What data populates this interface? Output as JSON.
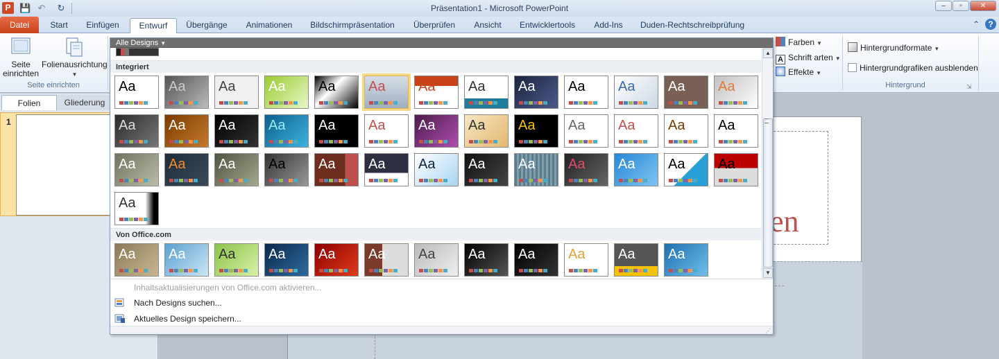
{
  "titlebar": {
    "title": "Präsentation1 - Microsoft PowerPoint",
    "app_icon_letter": "P",
    "quick_access": {
      "save": "💾",
      "undo": "↶",
      "redo": "↻"
    },
    "window_buttons": {
      "minimize": "–",
      "maximize": "▫",
      "close": "✕"
    }
  },
  "tabs": [
    {
      "label": "Datei"
    },
    {
      "label": "Start"
    },
    {
      "label": "Einfügen"
    },
    {
      "label": "Entwurf"
    },
    {
      "label": "Übergänge"
    },
    {
      "label": "Animationen"
    },
    {
      "label": "Bildschirmpräsentation"
    },
    {
      "label": "Überprüfen"
    },
    {
      "label": "Ansicht"
    },
    {
      "label": "Entwicklertools"
    },
    {
      "label": "Add-Ins"
    },
    {
      "label": "Duden-Rechtschreibprüfung"
    }
  ],
  "tab_help": {
    "minimize": "⌃",
    "help": "?"
  },
  "ribbon": {
    "page_setup": {
      "setup_line1": "Seite",
      "setup_line2": "einrichten",
      "orientation": "Folienausrichtung",
      "group_label": "Seite einrichten"
    },
    "design_opts": {
      "colors": "Farben",
      "fonts": "Schrift arten",
      "effects": "Effekte"
    },
    "background": {
      "formats": "Hintergrundformate",
      "hide_graphics": "Hintergrundgrafiken ausblenden",
      "group_label": "Hintergrund"
    }
  },
  "left_pane": {
    "tabs": [
      "Folien",
      "Gliederung"
    ],
    "slide_number": "1"
  },
  "slide": {
    "title_fragment": "en"
  },
  "gallery": {
    "header": "Alle Designs",
    "section_builtin": "Integriert",
    "section_office": "Von Office.com",
    "thumb_text": "Aa",
    "menu": {
      "office_update": "Inhaltsaktualisierungen von Office.com aktivieren...",
      "browse": "Nach Designs suchen...",
      "save": "Aktuelles Design speichern..."
    }
  },
  "colors": {
    "accent": "#c8421b",
    "ribbon_text": "#1e395b",
    "selection": "#f3d98b"
  }
}
